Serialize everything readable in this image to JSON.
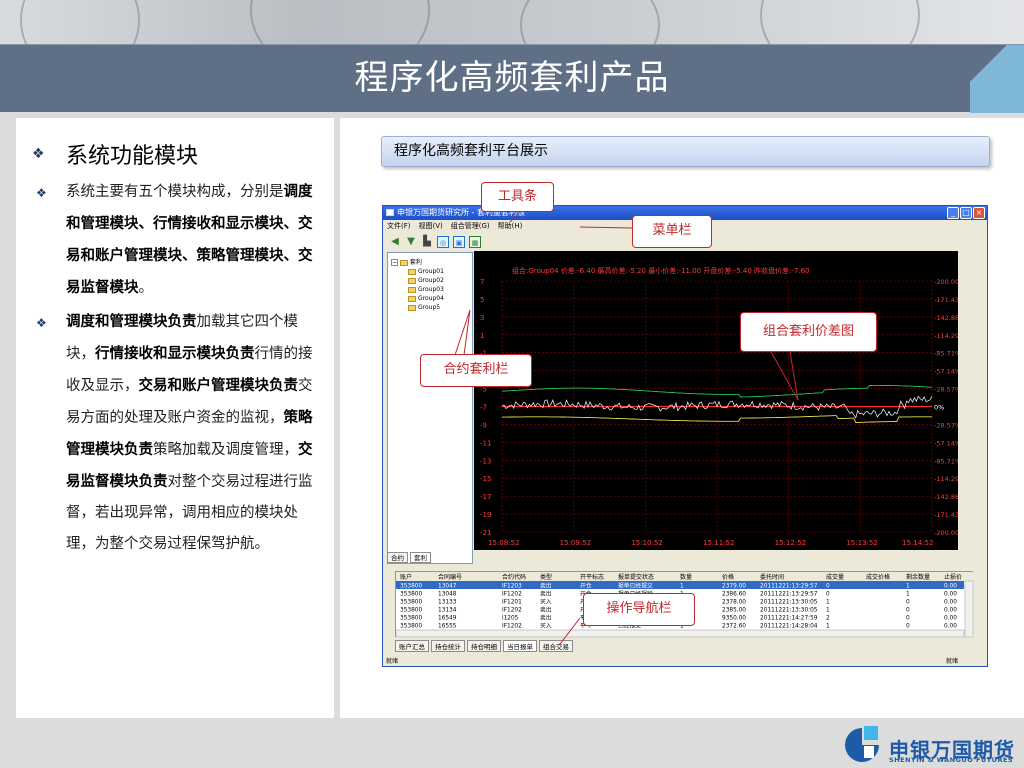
{
  "page": {
    "title": "程序化高频套利产品"
  },
  "left": {
    "heading": "系统功能模块",
    "bullet_symbol": "❖",
    "paragraphs": [
      [
        {
          "t": "系统主要有五个模块构成，分别是",
          "b": false
        },
        {
          "t": "调度和管理模块、行情接收和显示模块、交易和账户管理模块、策略管理模块、交易监督模块",
          "b": true
        },
        {
          "t": "。",
          "b": false
        }
      ],
      [
        {
          "t": "调度和管理模块负责",
          "b": true
        },
        {
          "t": "加载其它四个模块，",
          "b": false
        },
        {
          "t": "行情接收和显示模块负责",
          "b": true
        },
        {
          "t": "行情的接收及显示，",
          "b": false
        },
        {
          "t": "交易和账户管理模块负责",
          "b": true
        },
        {
          "t": "交易方面的处理及账户资金的监视，",
          "b": false
        },
        {
          "t": "策略管理模块负责",
          "b": true
        },
        {
          "t": "策略加载及调度管理，",
          "b": false
        },
        {
          "t": "交易监督模块负责",
          "b": true
        },
        {
          "t": "对整个交易过程进行监督，若出现异常，调用相应的模块处理，为整个交易过程保驾护航。",
          "b": false
        }
      ]
    ]
  },
  "platform": {
    "title": "程序化高频套利平台展示"
  },
  "callouts": {
    "toolbar": "工具条",
    "menubar": "菜单栏",
    "spread": "组合套利价差图",
    "contracts": "合约套利栏",
    "ops": "操作导航栏"
  },
  "app": {
    "window_title": "申银万国期货研究所 - 套利量套利版",
    "window_buttons": [
      "_",
      "□",
      "×"
    ],
    "menu": [
      "文件(F)",
      "视图(V)",
      "组合管理(G)",
      "帮助(H)"
    ],
    "toolbar_icons": [
      "◆",
      "◆",
      "▲",
      "▣",
      "▣",
      "▣"
    ],
    "tree": {
      "root": "套利",
      "items": [
        "Group01",
        "Group02",
        "Group03",
        "Group04",
        "Group5"
      ]
    },
    "tree_tabs": [
      "合约",
      "套利"
    ],
    "chart": {
      "header": "组合:Group04  价差:-6.40  最高价差:-5.20  最小价差:-11.00  开盘价差:-5.40  昨收盘价差:-7.60",
      "y_left": [
        "7",
        "5",
        "3",
        "1",
        "-1",
        "-3",
        "-5",
        "-7",
        "-9",
        "-11",
        "-13",
        "-15",
        "-17",
        "-19",
        "-21"
      ],
      "y_right": [
        "-200.00%",
        "-171.43%",
        "-142.86%",
        "-114.29%",
        "-85.71%",
        "-57.14%",
        "-28.57%",
        "0%",
        "-28.57%",
        "-57.14%",
        "-85.71%",
        "-114.29%",
        "-142.86%",
        "-171.43%",
        "-200.00%"
      ],
      "x": [
        "15:08:52",
        "15:09:52",
        "15:10:52",
        "15:11:52",
        "15:12:52",
        "15:13:52",
        "15:14:52"
      ]
    },
    "grid": {
      "columns": [
        "账户",
        "合同编号",
        "合约代码",
        "类型",
        "开平标志",
        "报单提交状态",
        "数量",
        "价格",
        "委托时间",
        "成交量",
        "成交价格",
        "剩余数量",
        "止损价"
      ],
      "rows": [
        [
          "353800",
          "13047",
          "IF1203",
          "卖出",
          "开仓",
          "报单已经提交",
          "1",
          "2379.00",
          "20111221:13:29:57",
          "0",
          "",
          "1",
          "0.00"
        ],
        [
          "353800",
          "13048",
          "IF1202",
          "卖出",
          "开仓",
          "报单已经报销",
          "1",
          "2386.60",
          "20111221:13:29:57",
          "0",
          "",
          "1",
          "0.00"
        ],
        [
          "353800",
          "13133",
          "IF1201",
          "买入",
          "开仓",
          "已经报交",
          "1",
          "2378.00",
          "20111221:13:30:05",
          "1",
          "",
          "0",
          "0.00"
        ],
        [
          "353800",
          "13134",
          "IF1202",
          "卖出",
          "开仓",
          "已经报交",
          "1",
          "2385.00",
          "20111221:13:30:05",
          "1",
          "",
          "0",
          "0.00"
        ],
        [
          "353800",
          "16549",
          "l1205",
          "卖出",
          "平今",
          "已经报交",
          "2",
          "9350.00",
          "20111221:14:27:59",
          "2",
          "",
          "0",
          "0.00"
        ],
        [
          "353800",
          "16555",
          "IF1202",
          "买入",
          "平今",
          "已经报交",
          "1",
          "2372.60",
          "20111221:14:28:04",
          "1",
          "",
          "0",
          "0.00"
        ]
      ]
    },
    "bottom_tabs": [
      "账户汇总",
      "持仓统计",
      "持仓明细",
      "当日报单",
      "组合交易"
    ],
    "status_left": "就绪",
    "status_right": "就绪"
  },
  "footer": {
    "logo_main": "申银万国期货",
    "logo_sub": "SHENYIN & WANGUO FUTURES"
  },
  "colors": {
    "title_bar": "#5f6f86",
    "callout": "#c0282d",
    "chart_bg": "#000000",
    "axis_left": "#ff3b3b",
    "axis_right": "#ff3b3b",
    "grid": "#8b0000",
    "line_upper": "#22c55e",
    "line_lower": "#e5e04a",
    "line_spread": "#ffffff",
    "zero_line": "#ff2a2a",
    "brand": "#1e5aa8"
  }
}
